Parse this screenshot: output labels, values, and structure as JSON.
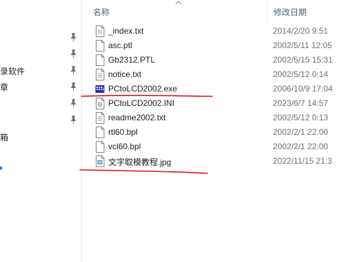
{
  "nav": {
    "items": [
      {
        "label": "录软件"
      },
      {
        "label": "章"
      },
      {
        "label": "箱"
      }
    ]
  },
  "header": {
    "name_label": "名称",
    "date_label": "修改日期"
  },
  "files": [
    {
      "name": "_index.txt",
      "date": "2014/2/20 9:51",
      "icon": "text-file-icon"
    },
    {
      "name": "asc.ptl",
      "date": "2002/5/11 12:05",
      "icon": "generic-file-icon"
    },
    {
      "name": "Gb2312.PTL",
      "date": "2002/5/15 15:31",
      "icon": "generic-file-icon"
    },
    {
      "name": "notice.txt",
      "date": "2002/5/12 0:14",
      "icon": "text-file-icon"
    },
    {
      "name": "PCtoLCD2002.exe",
      "date": "2006/10/9 17:04",
      "icon": "app-exe-icon"
    },
    {
      "name": "PCtoLCD2002.INI",
      "date": "2023/6/7 14:57",
      "icon": "settings-file-icon"
    },
    {
      "name": "readme2002.txt",
      "date": "2002/5/12 0:13",
      "icon": "text-file-icon"
    },
    {
      "name": "rtl60.bpl",
      "date": "2002/2/1 22:00",
      "icon": "generic-file-icon"
    },
    {
      "name": "vcl60.bpl",
      "date": "2002/2/1 22:00",
      "icon": "generic-file-icon"
    },
    {
      "name": "文字取模教程.jpg",
      "date": "2022/11/15 21:3",
      "icon": "image-file-icon"
    }
  ],
  "colors": {
    "annotation": "#d8101a",
    "header_text": "#4c607a",
    "accent": "#2c7cd6"
  }
}
